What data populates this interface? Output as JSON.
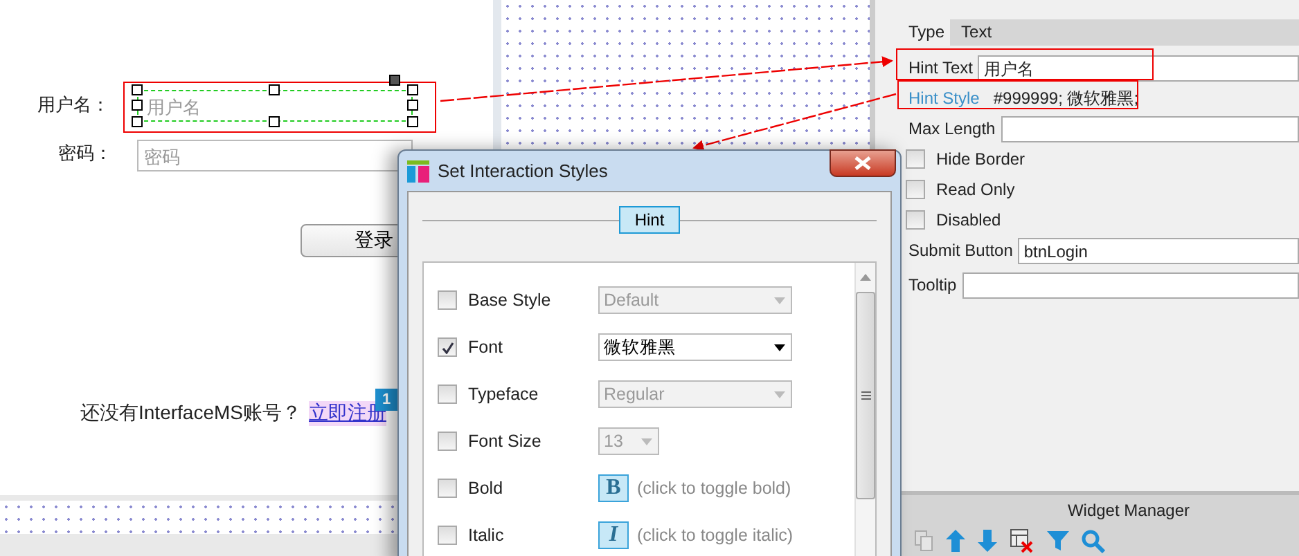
{
  "canvas": {
    "fields": [
      {
        "label": "用户名：",
        "placeholder": "用户名",
        "selected": true
      },
      {
        "label": "密码：",
        "placeholder": "密码",
        "selected": false
      }
    ],
    "login_button": "登录",
    "register_prompt": "还没有InterfaceMS账号？",
    "register_link": "立即注册",
    "footnote_badge": "1"
  },
  "properties": {
    "type_label": "Type",
    "type_value": "Text",
    "hint_text_label": "Hint Text",
    "hint_text_value": "用户名",
    "hint_style_label": "Hint Style",
    "hint_style_value": "#999999; 微软雅黑;",
    "max_length_label": "Max Length",
    "options": [
      {
        "label": "Hide Border",
        "checked": false
      },
      {
        "label": "Read Only",
        "checked": false
      },
      {
        "label": "Disabled",
        "checked": false
      }
    ],
    "submit_button_label": "Submit Button",
    "submit_button_value": "btnLogin",
    "tooltip_label": "Tooltip"
  },
  "widget_manager": {
    "title": "Widget Manager"
  },
  "dialog": {
    "title": "Set Interaction Styles",
    "tab": "Hint",
    "rows": [
      {
        "kind": "dropdown",
        "label": "Base Style",
        "checked": false,
        "value": "Default",
        "disabled": true
      },
      {
        "kind": "dropdown",
        "label": "Font",
        "checked": true,
        "value": "微软雅黑",
        "disabled": false
      },
      {
        "kind": "dropdown",
        "label": "Typeface",
        "checked": false,
        "value": "Regular",
        "disabled": true
      },
      {
        "kind": "small-dropdown",
        "label": "Font Size",
        "checked": false,
        "value": "13",
        "disabled": true
      },
      {
        "kind": "toggle",
        "label": "Bold",
        "checked": false,
        "glyph": "B",
        "hint": "(click to toggle bold)"
      },
      {
        "kind": "toggle",
        "label": "Italic",
        "checked": false,
        "glyph": "I",
        "hint": "(click to toggle italic)"
      }
    ]
  }
}
